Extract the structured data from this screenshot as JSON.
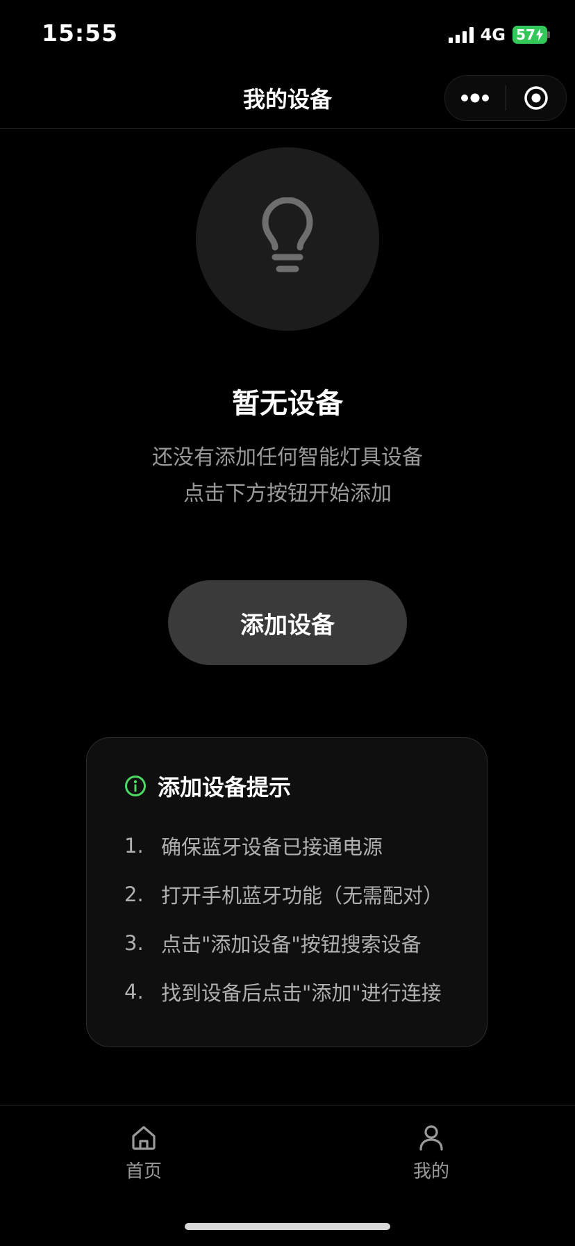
{
  "status_bar": {
    "time": "15:55",
    "network": "4G",
    "battery": "57"
  },
  "nav": {
    "title": "我的设备"
  },
  "empty_state": {
    "icon": "lightbulb-icon",
    "title": "暂无设备",
    "description_line1": "还没有添加任何智能灯具设备",
    "description_line2": "点击下方按钮开始添加"
  },
  "add_button": {
    "label": "添加设备"
  },
  "tips": {
    "title": "添加设备提示",
    "accent_color": "#4cd964",
    "items": [
      {
        "num": "1.",
        "text": "确保蓝牙设备已接通电源"
      },
      {
        "num": "2.",
        "text": "打开手机蓝牙功能（无需配对）"
      },
      {
        "num": "3.",
        "text": "点击\"添加设备\"按钮搜索设备"
      },
      {
        "num": "4.",
        "text": "找到设备后点击\"添加\"进行连接"
      }
    ]
  },
  "tab_bar": {
    "items": [
      {
        "label": "首页",
        "icon": "home-icon"
      },
      {
        "label": "我的",
        "icon": "user-icon"
      }
    ]
  },
  "colors": {
    "background": "#000000",
    "battery": "#34c759",
    "button": "#3a3a3a"
  }
}
